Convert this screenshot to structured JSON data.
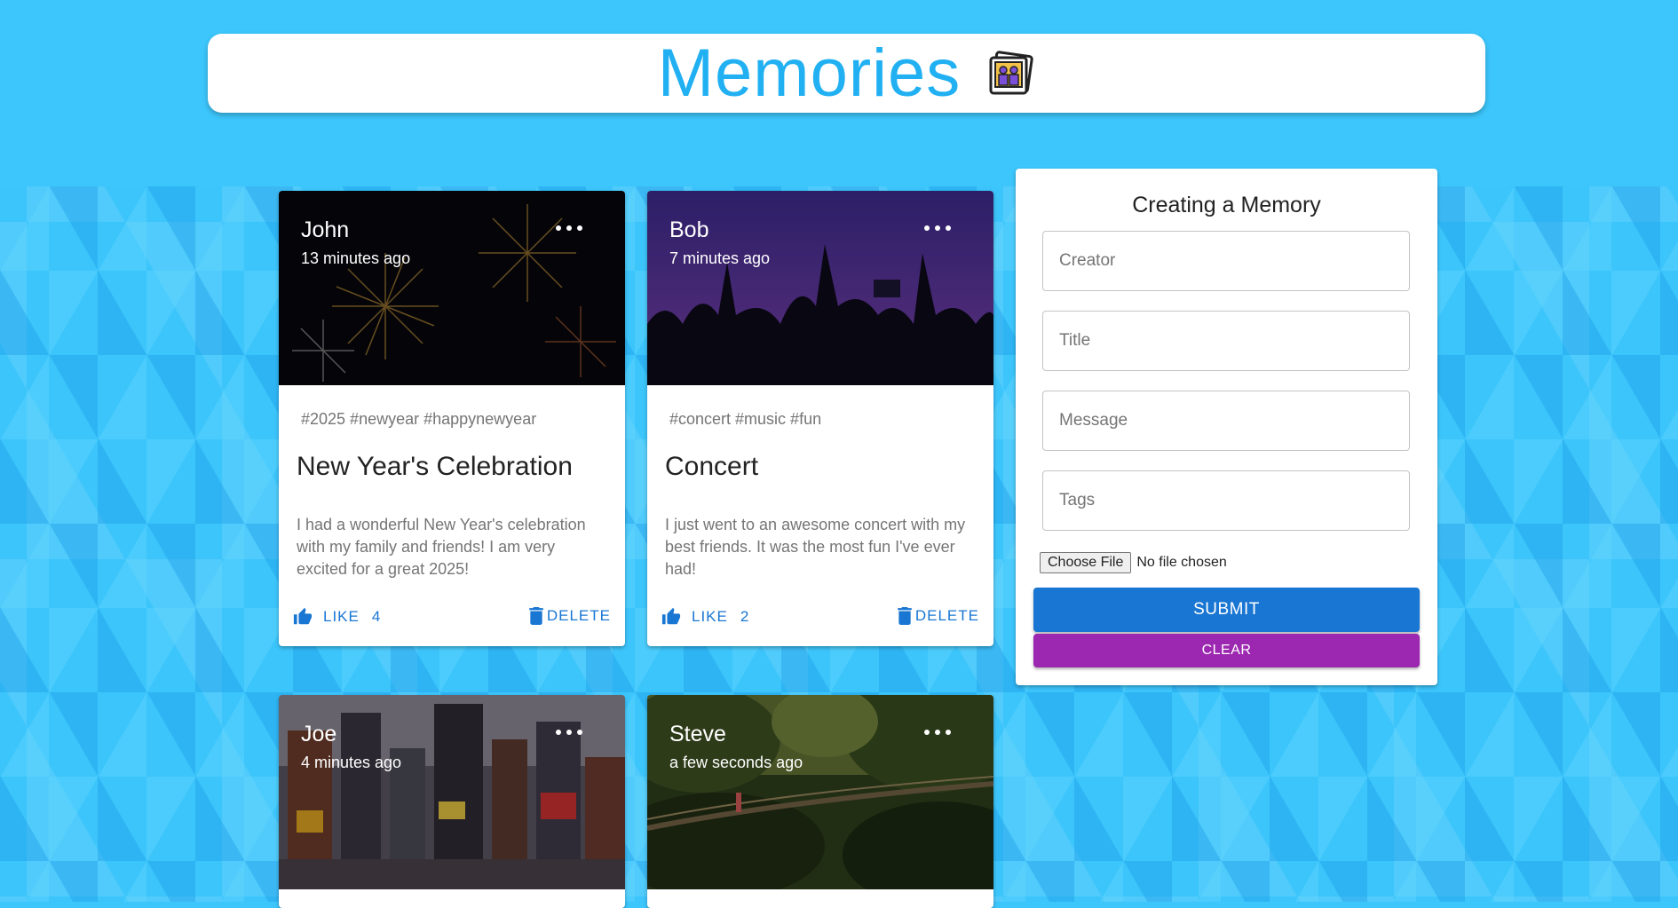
{
  "header": {
    "title": "Memories",
    "logo_icon": "photo-album-icon"
  },
  "posts": [
    {
      "creator": "John",
      "time": "13 minutes ago",
      "tags": "#2025 #newyear #happynewyear",
      "title": "New Year's Celebration",
      "message": "I had a wonderful New Year's celebration with my family and friends! I am very excited for a great 2025!",
      "like_label": "LIKE",
      "like_count": "4",
      "delete_label": "DELETE",
      "image": "fireworks"
    },
    {
      "creator": "Bob",
      "time": "7 minutes ago",
      "tags": "#concert #music #fun",
      "title": "Concert",
      "message": "I just went to an awesome concert with my best friends. It was the most fun I've ever had!",
      "like_label": "LIKE",
      "like_count": "2",
      "delete_label": "DELETE",
      "image": "concert-crowd"
    },
    {
      "creator": "Joe",
      "time": "4 minutes ago",
      "image": "city-street"
    },
    {
      "creator": "Steve",
      "time": "a few seconds ago",
      "image": "jungle-bridge"
    }
  ],
  "form": {
    "title": "Creating a Memory",
    "creator_placeholder": "Creator",
    "title_placeholder": "Title",
    "message_placeholder": "Message",
    "tags_placeholder": "Tags",
    "file_button": "Choose File",
    "file_status": "No file chosen",
    "submit_label": "SUBMIT",
    "clear_label": "CLEAR"
  },
  "colors": {
    "background": "#3cc6fb",
    "title": "#21b0f2",
    "primary": "#1976d2",
    "secondary": "#9c27b0"
  }
}
